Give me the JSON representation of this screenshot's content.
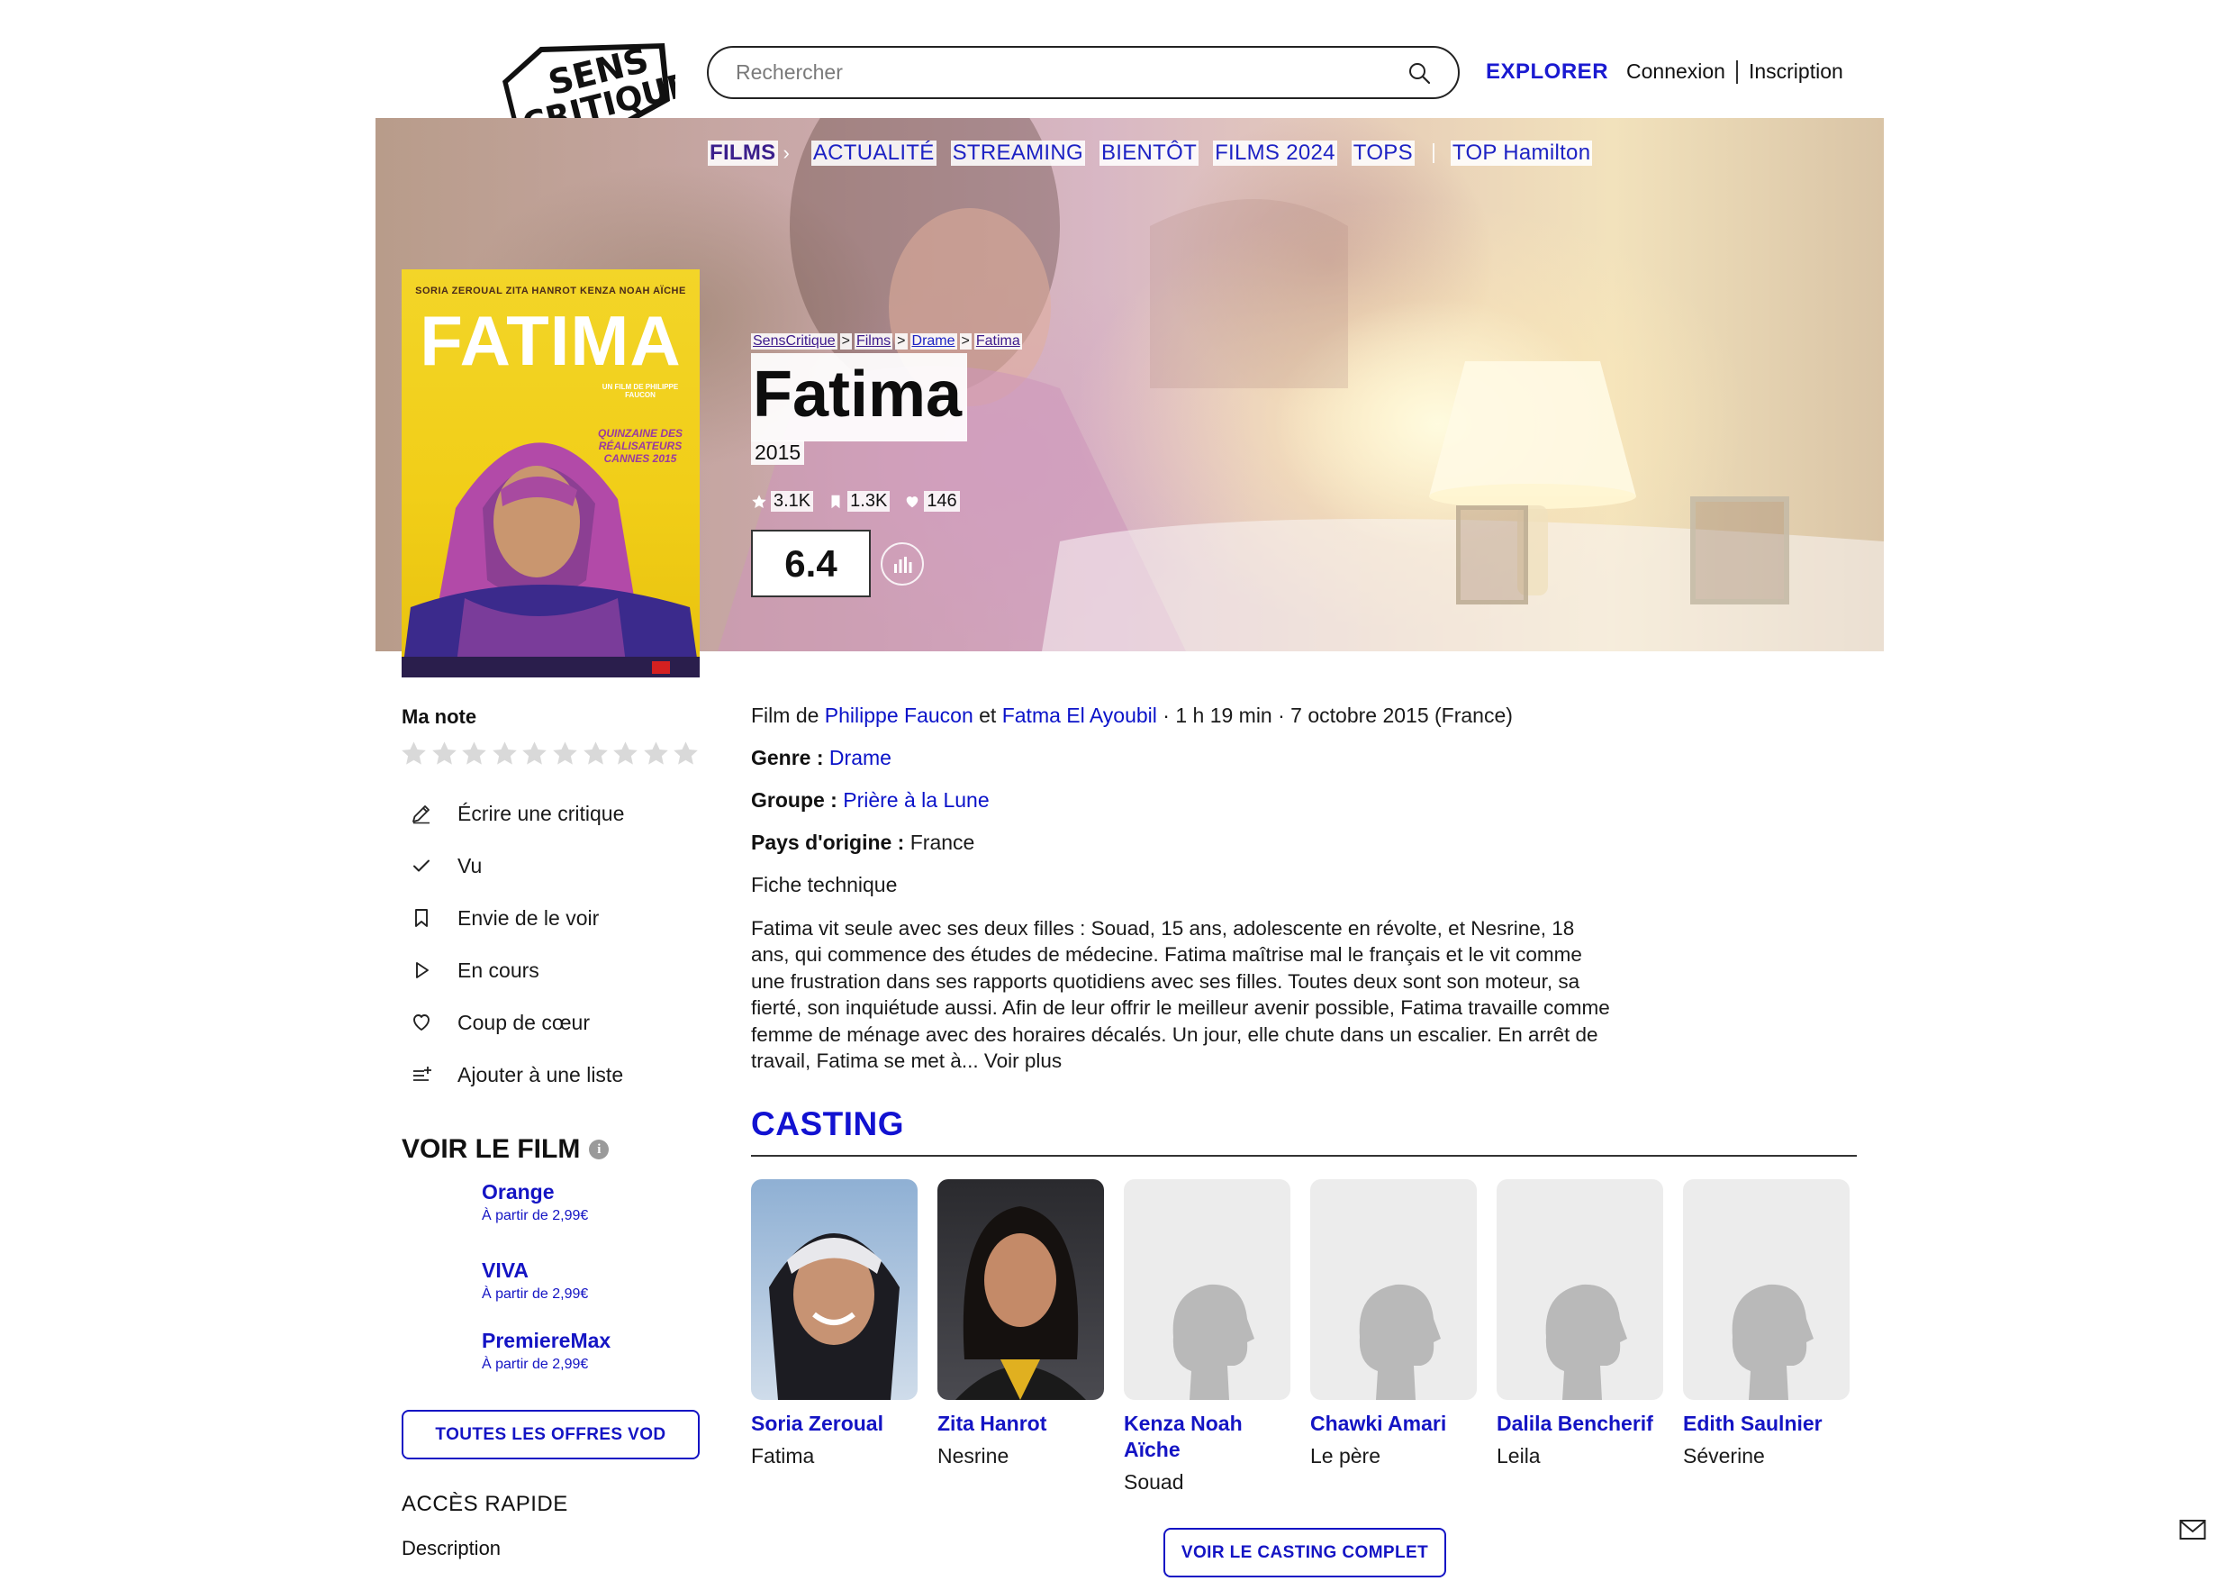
{
  "header": {
    "logo_text": [
      "SENS",
      "CRITIQUE"
    ],
    "search_placeholder": "Rechercher",
    "explorer": "EXPLORER",
    "login": "Connexion",
    "signup": "Inscription"
  },
  "nav": {
    "films": "FILMS",
    "items": [
      "ACTUALITÉ",
      "STREAMING",
      "BIENTÔT",
      "FILMS 2024",
      "TOPS"
    ],
    "top_hamilton": "TOP Hamilton"
  },
  "poster": {
    "credits": "SORIA ZEROUAL   ZITA HANROT   KENZA NOAH AÏCHE",
    "title": "FATIMA",
    "director": "UN FILM DE PHILIPPE FAUCON",
    "festival": "QUINZAINE DES RÉALISATEURS CANNES 2015"
  },
  "breadcrumb": [
    "SensCritique",
    "Films",
    "Drame",
    "Fatima"
  ],
  "film": {
    "title": "Fatima",
    "year": "2015",
    "ratings_count": "3.1K",
    "wishlist_count": "1.3K",
    "favorites_count": "146",
    "score": "6.4"
  },
  "sidebar": {
    "my_rating": "Ma note",
    "actions": [
      {
        "label": "Écrire une critique",
        "icon": "pencil-icon"
      },
      {
        "label": "Vu",
        "icon": "check-icon"
      },
      {
        "label": "Envie de le voir",
        "icon": "bookmark-icon"
      },
      {
        "label": "En cours",
        "icon": "play-icon"
      },
      {
        "label": "Coup de cœur",
        "icon": "heart-icon"
      },
      {
        "label": "Ajouter à une liste",
        "icon": "list-add-icon"
      }
    ],
    "watch_title": "VOIR LE FILM",
    "vod": [
      {
        "name": "Orange",
        "price": "À partir de 2,99€"
      },
      {
        "name": "VIVA",
        "price": "À partir de 2,99€"
      },
      {
        "name": "PremiereMax",
        "price": "À partir de 2,99€"
      }
    ],
    "all_vod": "TOUTES LES OFFRES VOD",
    "quick_access": "ACCÈS RAPIDE",
    "description_link": "Description"
  },
  "details": {
    "film_de": "Film de",
    "director1": "Philippe Faucon",
    "et": "et",
    "director2": "Fatma El Ayoubil",
    "meta": "· 1 h 19 min · 7 octobre 2015 (France)",
    "genre_label": "Genre :",
    "genre": "Drame",
    "group_label": "Groupe :",
    "group": "Prière à la Lune",
    "country_label": "Pays d'origine :",
    "country": "France",
    "tech_sheet": "Fiche technique",
    "synopsis": "Fatima vit seule avec ses deux filles : Souad, 15 ans, adolescente en révolte, et Nesrine, 18 ans, qui commence des études de médecine. Fatima maîtrise mal le français et le vit comme une frustration dans ses rapports quotidiens avec ses filles. Toutes deux sont son moteur, sa fierté, son inquiétude aussi. Afin de leur offrir le meilleur avenir possible, Fatima travaille comme femme de ménage avec des horaires décalés. Un jour, elle chute dans un escalier. En arrêt de travail, Fatima se met à...",
    "read_more": "Voir plus"
  },
  "casting": {
    "title": "CASTING",
    "actors": [
      {
        "name": "Soria Zeroual",
        "role": "Fatima",
        "photo": "photo"
      },
      {
        "name": "Zita Hanrot",
        "role": "Nesrine",
        "photo": "photo"
      },
      {
        "name": "Kenza Noah Aïche",
        "role": "Souad",
        "photo": "placeholder"
      },
      {
        "name": "Chawki Amari",
        "role": "Le père",
        "photo": "placeholder"
      },
      {
        "name": "Dalila Bencherif",
        "role": "Leila",
        "photo": "placeholder"
      },
      {
        "name": "Edith Saulnier",
        "role": "Séverine",
        "photo": "placeholder"
      }
    ],
    "full_cast_button": "VOIR LE CASTING COMPLET"
  },
  "colors": {
    "accent": "#1414c4",
    "poster_yellow": "#f1ce18"
  }
}
